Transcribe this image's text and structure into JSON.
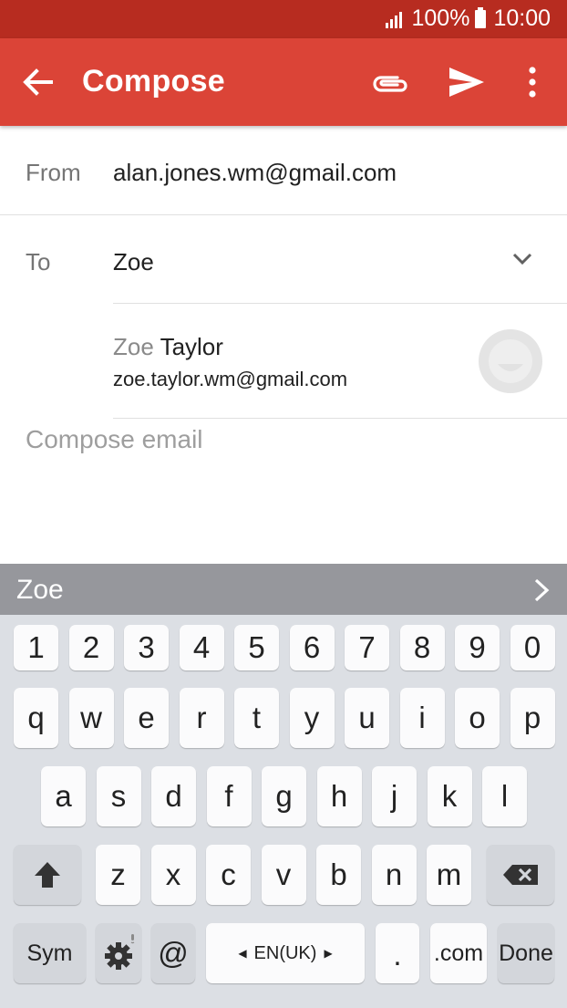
{
  "status": {
    "battery": "100%",
    "time": "10:00"
  },
  "app_bar": {
    "title": "Compose",
    "icons": [
      "back-arrow-icon",
      "paperclip-icon",
      "send-icon",
      "more-vert-icon"
    ]
  },
  "form": {
    "from_label": "From",
    "from_value": "alan.jones.wm@gmail.com",
    "to_label": "To",
    "to_value": "Zoe",
    "suggestion": {
      "name_match": "Zoe",
      "name_rest": " Taylor",
      "email": "zoe.taylor.wm@gmail.com"
    },
    "body_placeholder": "Compose email"
  },
  "prediction": {
    "word": "Zoe"
  },
  "keyboard": {
    "numbers": [
      "1",
      "2",
      "3",
      "4",
      "5",
      "6",
      "7",
      "8",
      "9",
      "0"
    ],
    "row1": [
      "q",
      "w",
      "e",
      "r",
      "t",
      "y",
      "u",
      "i",
      "o",
      "p"
    ],
    "row2": [
      "a",
      "s",
      "d",
      "f",
      "g",
      "h",
      "j",
      "k",
      "l"
    ],
    "row3": [
      "z",
      "x",
      "c",
      "v",
      "b",
      "n",
      "m"
    ],
    "sym": "Sym",
    "at": "@",
    "language": "EN(UK)",
    "period": ".",
    "dotcom": ".com",
    "done": "Done"
  },
  "colors": {
    "status_bar": "#b72c20",
    "app_bar": "#db4437",
    "prediction_bar": "#96979c",
    "keyboard_bg": "#dcdfe4"
  }
}
